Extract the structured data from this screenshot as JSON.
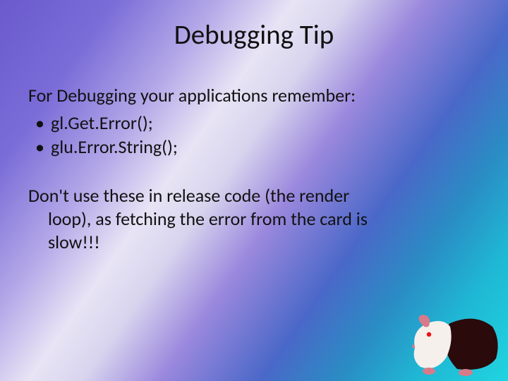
{
  "title": "Debugging Tip",
  "intro": "For Debugging your applications remember:",
  "bullets": [
    "gl.Get.Error();",
    "glu.Error.String();"
  ],
  "warning_line1": "Don't use these in release code (the render",
  "warning_line2": "loop), as fetching the error from the card is",
  "warning_line3": "slow!!!",
  "icon": "guinea-pig-icon"
}
